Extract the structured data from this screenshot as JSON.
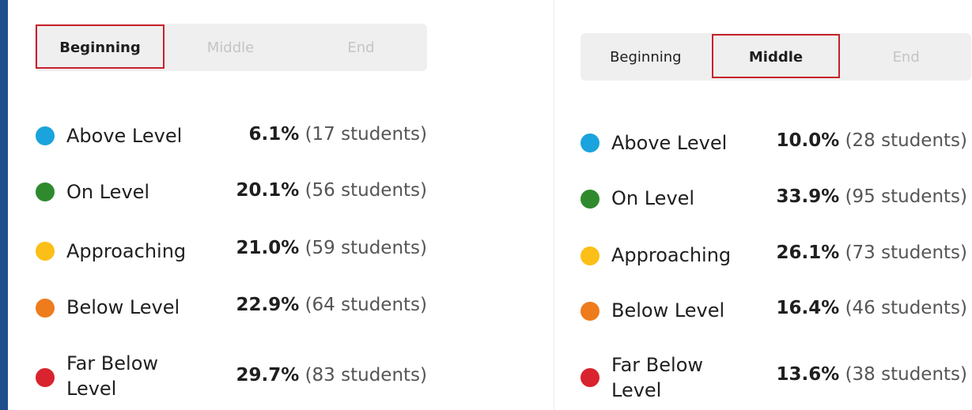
{
  "colors": {
    "above_level": "#1aa3dc",
    "on_level": "#2f8a2e",
    "approaching": "#fbbf17",
    "below_level": "#ee7b1c",
    "far_below_level": "#d9232e",
    "selected_outline": "#c8202a",
    "accent_bar": "#1d4f8c"
  },
  "tabs": [
    "Beginning",
    "Middle",
    "End"
  ],
  "panels": [
    {
      "selected_tab": "Beginning",
      "rows": [
        {
          "label": "Above Level",
          "percent": "6.1%",
          "students": "(17 students)"
        },
        {
          "label": "On Level",
          "percent": "20.1%",
          "students": "(56 students)"
        },
        {
          "label": "Approaching",
          "percent": "21.0%",
          "students": "(59 students)"
        },
        {
          "label": "Below Level",
          "percent": "22.9%",
          "students": "(64 students)"
        },
        {
          "label": "Far Below Level",
          "percent": "29.7%",
          "students": "(83 students)"
        }
      ]
    },
    {
      "selected_tab": "Middle",
      "rows": [
        {
          "label": "Above Level",
          "percent": "10.0%",
          "students": "(28 students)"
        },
        {
          "label": "On Level",
          "percent": "33.9%",
          "students": "(95 students)"
        },
        {
          "label": "Approaching",
          "percent": "26.1%",
          "students": "(73 students)"
        },
        {
          "label": "Below Level",
          "percent": "16.4%",
          "students": "(46 students)"
        },
        {
          "label": "Far Below Level",
          "percent": "13.6%",
          "students": "(38 students)"
        }
      ]
    }
  ]
}
